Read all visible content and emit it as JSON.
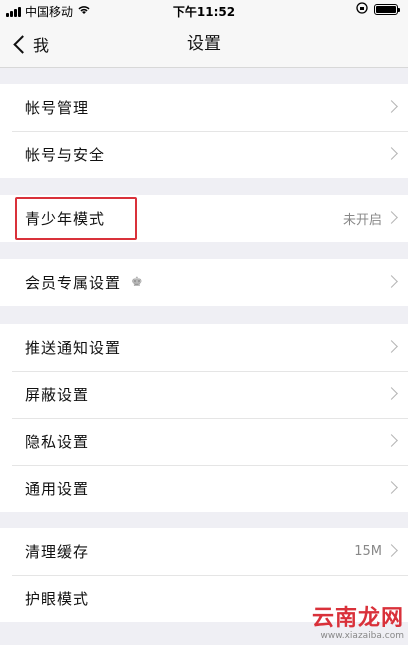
{
  "status_bar": {
    "carrier": "中国移动",
    "time": "下午11:52"
  },
  "nav": {
    "back_label": "我",
    "title": "设置"
  },
  "groups": [
    {
      "items": [
        {
          "label": "帐号管理"
        },
        {
          "label": "帐号与安全"
        }
      ]
    },
    {
      "items": [
        {
          "label": "青少年模式",
          "value": "未开启"
        }
      ]
    },
    {
      "items": [
        {
          "label": "会员专属设置",
          "icon": "crown-icon"
        }
      ]
    },
    {
      "items": [
        {
          "label": "推送通知设置"
        },
        {
          "label": "屏蔽设置"
        },
        {
          "label": "隐私设置"
        },
        {
          "label": "通用设置"
        }
      ]
    },
    {
      "items": [
        {
          "label": "清理缓存",
          "value": "15M"
        },
        {
          "label": "护眼模式"
        }
      ]
    }
  ],
  "watermark": {
    "title": "云南龙网",
    "url": "www.xiazaiba.com"
  },
  "colors": {
    "highlight": "#d9313a",
    "background": "#efeff4"
  }
}
